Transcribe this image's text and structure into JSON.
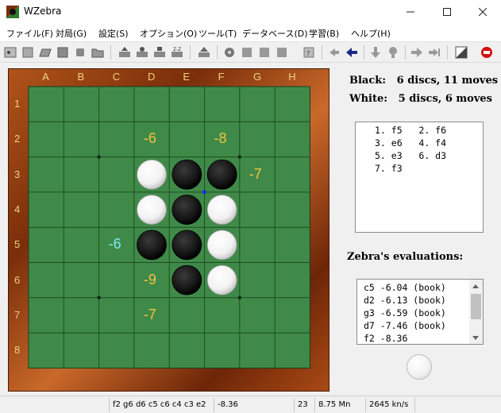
{
  "window": {
    "title": "WZebra"
  },
  "menu": [
    "ファイル(F)",
    "対局(G)",
    "設定(S)",
    "オプション(O)",
    "ツール(T)",
    "データベース(D)",
    "学習(B)",
    "ヘルプ(H)"
  ],
  "toolbar_icons": [
    "new-board-icon",
    "new-game-icon",
    "open-game-icon",
    "save-game-icon",
    "print-icon",
    "folder-icon",
    "load-position-icon",
    "save-position-icon",
    "copy-position-icon",
    "paste-position-icon",
    "setup-board-icon",
    "analyze-icon",
    "stop-icon",
    "pause-icon",
    "resume-icon",
    "book-icon",
    "first-move-icon",
    "back-move-icon",
    "down-arrow-icon",
    "hint-icon",
    "forward-move-icon",
    "last-move-icon",
    "flip-board-icon",
    "quit-icon"
  ],
  "board": {
    "columns": [
      "A",
      "B",
      "C",
      "D",
      "E",
      "F",
      "G",
      "H"
    ],
    "rows": [
      "1",
      "2",
      "3",
      "4",
      "5",
      "6",
      "7",
      "8"
    ],
    "discs": [
      {
        "square": "D3",
        "color": "white"
      },
      {
        "square": "E3",
        "color": "black"
      },
      {
        "square": "F3",
        "color": "black"
      },
      {
        "square": "D4",
        "color": "white"
      },
      {
        "square": "E4",
        "color": "black"
      },
      {
        "square": "F4",
        "color": "white"
      },
      {
        "square": "D5",
        "color": "black"
      },
      {
        "square": "E5",
        "color": "black"
      },
      {
        "square": "F5",
        "color": "white"
      },
      {
        "square": "E6",
        "color": "black"
      },
      {
        "square": "F6",
        "color": "white"
      }
    ],
    "evaluations": [
      {
        "square": "D2",
        "text": "-6",
        "color": "#f5c040"
      },
      {
        "square": "F2",
        "text": "-8",
        "color": "#f5c040"
      },
      {
        "square": "G3",
        "text": "-7",
        "color": "#f5c040"
      },
      {
        "square": "C5",
        "text": "-6",
        "color": "#7fe8f0"
      },
      {
        "square": "D6",
        "text": "-9",
        "color": "#f5c040"
      },
      {
        "square": "D7",
        "text": "-7",
        "color": "#f5c040"
      }
    ],
    "last_move_marker": "F3",
    "colors": {
      "felt": "#3f8a48",
      "grid": "#1f4d25",
      "frame_label": "#f0d080"
    }
  },
  "info": {
    "black": "Black:   6 discs, 11 moves",
    "white": "White:   5 discs, 6 moves"
  },
  "moves": [
    [
      "1. f5",
      "2. f6"
    ],
    [
      "3. e6",
      "4. f4"
    ],
    [
      "5. e3",
      "6. d3"
    ],
    [
      "7. f3",
      ""
    ]
  ],
  "evaluations_panel": {
    "title": "Zebra's evaluations:",
    "rows": [
      "c5 -6.04 (book)",
      "d2 -6.13 (book)",
      "g3 -6.59 (book)",
      "d7 -7.46 (book)",
      "f2 -8.36"
    ]
  },
  "status": {
    "line": "f2 g6 d6 c5 c6 c4 c3 e2",
    "eval": "-8.36",
    "depth": "23",
    "nodes": "8.75 Mn",
    "speed": "2645 kn/s"
  }
}
